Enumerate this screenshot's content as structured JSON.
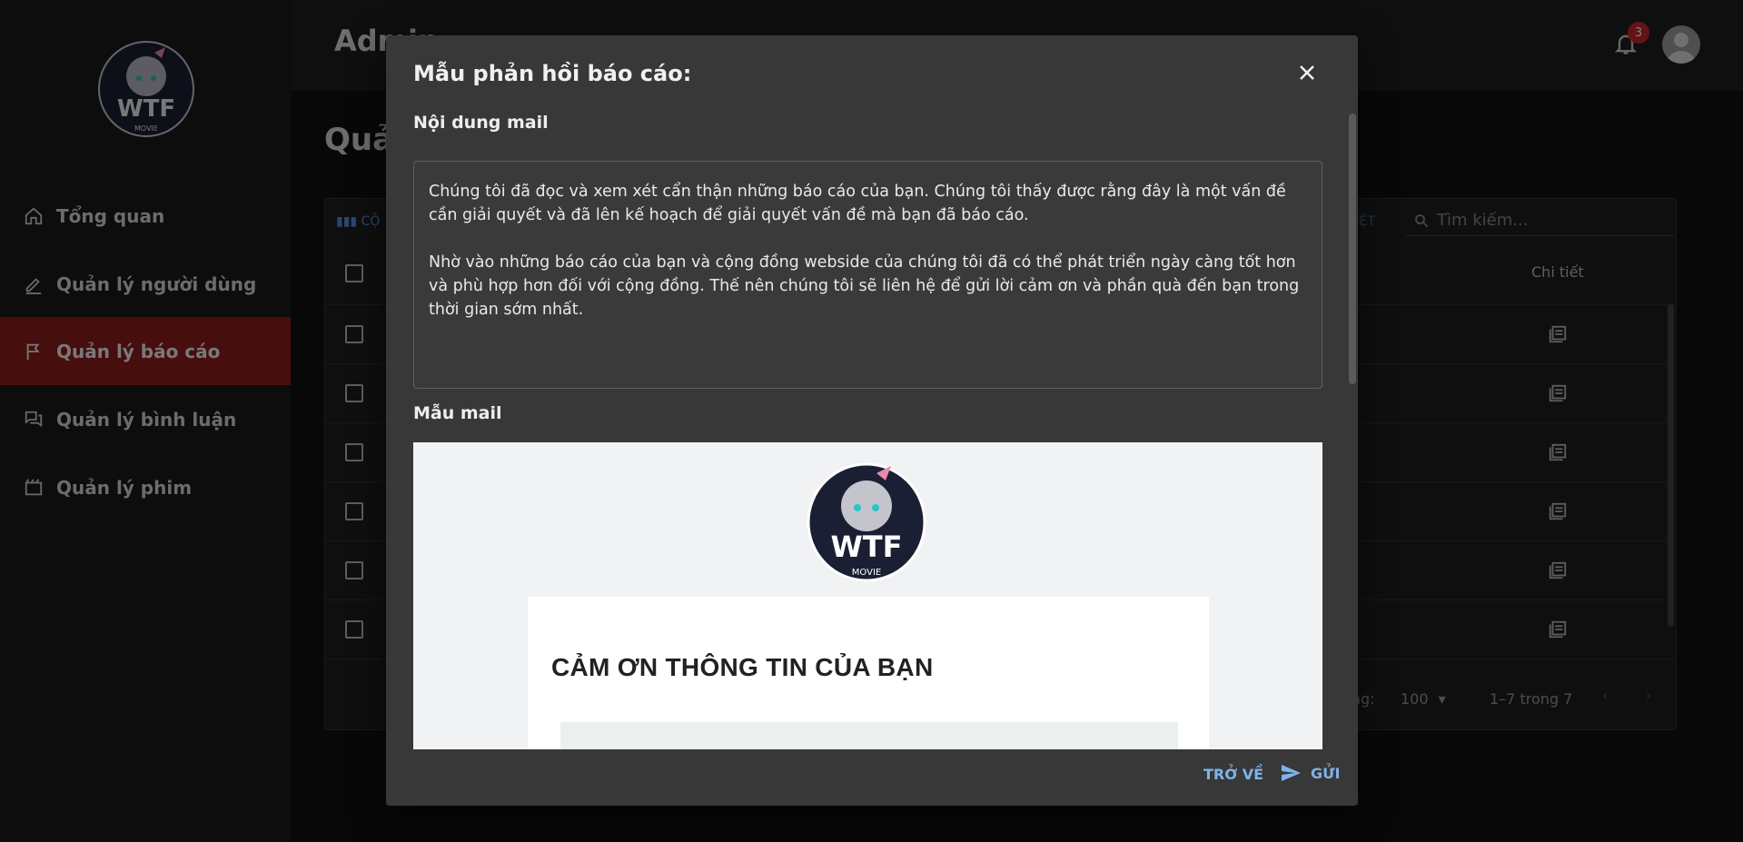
{
  "header": {
    "title": "Admin",
    "notification_count": "3"
  },
  "sidebar": {
    "logo_text": "WTF",
    "logo_subtext": "MOVIE",
    "items": [
      {
        "label": "Tổng quan",
        "icon": "home-icon"
      },
      {
        "label": "Quản lý người dùng",
        "icon": "edit-icon"
      },
      {
        "label": "Quản lý báo cáo",
        "icon": "flag-icon",
        "active": true
      },
      {
        "label": "Quản lý bình luận",
        "icon": "forum-icon"
      },
      {
        "label": "Quản lý phim",
        "icon": "movie-icon"
      }
    ]
  },
  "main": {
    "page_title": "Quả",
    "grid": {
      "toolbar_columns_label": "CỘ",
      "toolbar_button_fragment": "YỆT",
      "search_placeholder": "Tìm kiếm...",
      "detail_column_header": "Chi tiết",
      "rows_per_page_label": "àng:",
      "rows_per_page_value": "100",
      "pagination_text": "1–7 trong 7"
    }
  },
  "dialog": {
    "title": "Mẫu phản hồi báo cáo:",
    "content_label": "Nội dung mail",
    "content_paragraph_1": "Chúng tôi đã đọc và xem xét cẩn thận những báo cáo của bạn. Chúng tôi thấy được rằng đây là một vấn đề cần giải quyết và đã lên kế hoạch để giải quyết vấn đề mà bạn đã báo cáo.",
    "content_paragraph_2": "Nhờ vào những báo cáo của bạn và cộng đồng webside của chúng tôi đã có thể phát triển ngày càng tốt hơn và phù hợp hơn đối với cộng đồng. Thế nên chúng tôi sẽ liên hệ để gửi lời cảm ơn và phần quà đến bạn trong thời gian sớm nhất.",
    "template_label": "Mẫu mail",
    "preview_heading": "CẢM ƠN THÔNG TIN CỦA BẠN",
    "back_button": "TRỞ VỀ",
    "send_button": "GỬI"
  },
  "colors": {
    "accent": "#7fb3ea",
    "active_nav": "#8f1c1c",
    "badge": "#c62828"
  }
}
